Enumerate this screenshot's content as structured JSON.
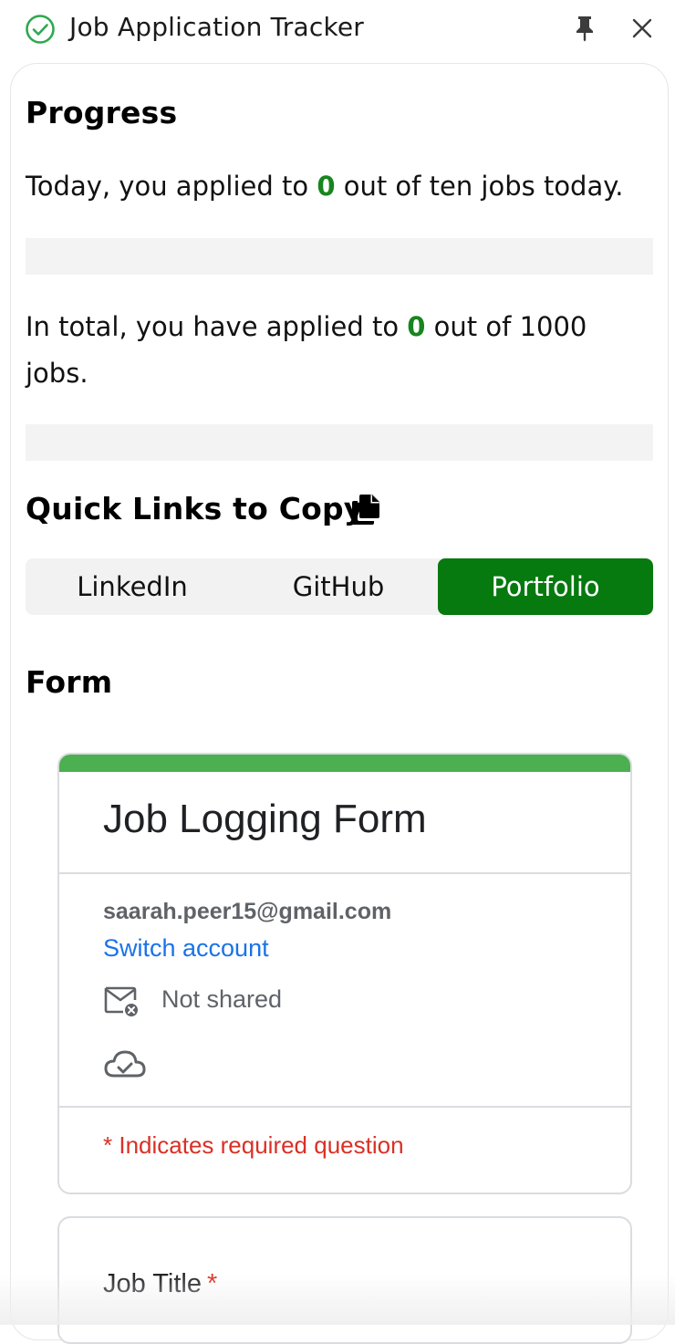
{
  "window": {
    "title": "Job Application Tracker",
    "icons": {
      "status": "check-circle-icon",
      "pin": "pin-icon",
      "close": "close-icon"
    }
  },
  "progress": {
    "heading": "Progress",
    "today": {
      "prefix": "Today, you applied to ",
      "count": "0",
      "suffix": " out of ten jobs today.",
      "fraction": 0
    },
    "total": {
      "prefix": "In total, you have applied to ",
      "count": "0",
      "suffix": " out of 1000 jobs.",
      "fraction": 0
    }
  },
  "quick_links": {
    "heading": "Quick Links to Copy",
    "icon": "copy-icon",
    "items": [
      {
        "label": "LinkedIn",
        "active": false
      },
      {
        "label": "GitHub",
        "active": false
      },
      {
        "label": "Portfolio",
        "active": true
      }
    ]
  },
  "form_section": {
    "heading": "Form",
    "google_form": {
      "title": "Job Logging Form",
      "email": "saarah.peer15@gmail.com",
      "switch_account": "Switch account",
      "not_shared": "Not shared",
      "required_note": "* Indicates required question",
      "first_question": {
        "label": "Job Title",
        "required_mark": "*"
      }
    }
  },
  "colors": {
    "accent_green": "#06790f",
    "count_green": "#18851f",
    "form_header_green": "#4caf50",
    "link_blue": "#1a73e8",
    "required_red": "#d93025"
  }
}
